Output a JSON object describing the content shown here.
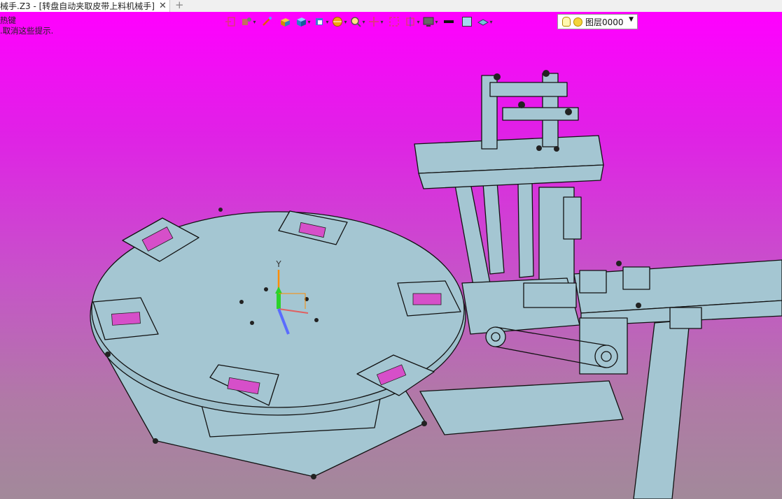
{
  "window": {
    "tab_title": "械手.Z3 - [转盘自动夹取皮带上料机械手]",
    "close_glyph": "✕",
    "new_tab_glyph": "+"
  },
  "hint": {
    "line1": "热键",
    "line2": ".取消这些提示."
  },
  "toolbar": {
    "layer_value": "图层0000"
  },
  "colors": {
    "part_fill": "#a4c6d2",
    "outline": "#111111",
    "bg_top": "#ff00ff",
    "bg_bottom": "#a2899a"
  }
}
